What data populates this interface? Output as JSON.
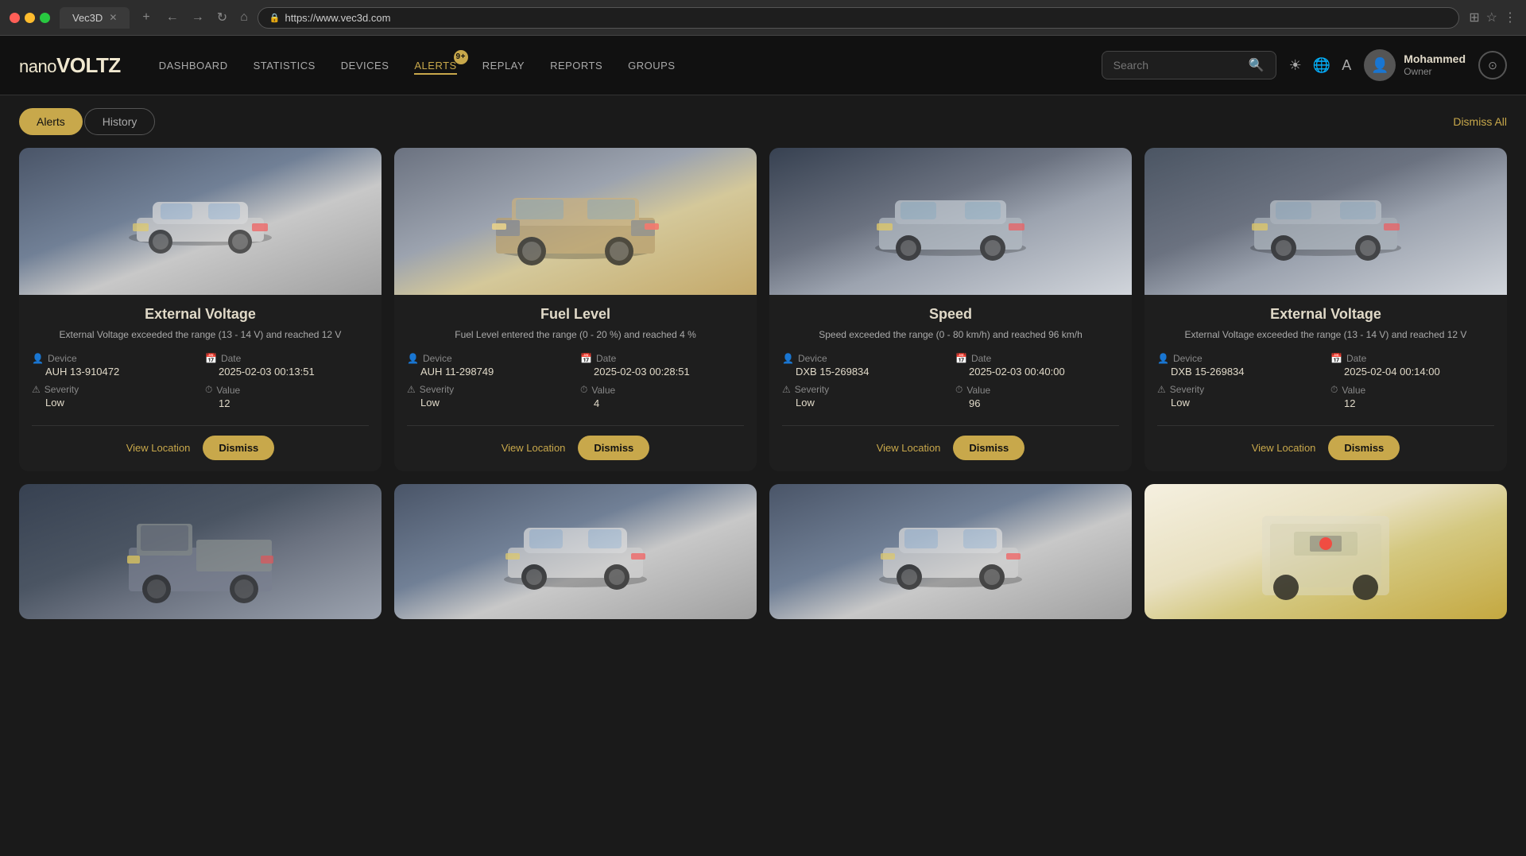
{
  "browser": {
    "tab_title": "Vec3D",
    "url": "https://www.vec3d.com",
    "plus_label": "+"
  },
  "header": {
    "logo": "nanoVOLTZ",
    "nav": [
      {
        "label": "DASHBOARD",
        "active": false
      },
      {
        "label": "STATISTICS",
        "active": false
      },
      {
        "label": "DEVICES",
        "active": false
      },
      {
        "label": "ALERTS",
        "active": true,
        "badge": "9+"
      },
      {
        "label": "REPLAY",
        "active": false
      },
      {
        "label": "REPORTS",
        "active": false
      },
      {
        "label": "GROUPS",
        "active": false
      }
    ],
    "search_placeholder": "Search",
    "user_name": "Mohammed",
    "user_role": "Owner"
  },
  "page": {
    "tabs": [
      {
        "label": "Alerts",
        "active": true
      },
      {
        "label": "History",
        "active": false
      }
    ],
    "dismiss_all_label": "Dismiss All"
  },
  "alerts": [
    {
      "id": 1,
      "title": "External Voltage",
      "description": "External Voltage exceeded the range (13 - 14 V) and reached 12 V",
      "device_label": "Device",
      "device_value": "AUH 13-910472",
      "date_label": "Date",
      "date_value": "2025-02-03 00:13:51",
      "severity_label": "Severity",
      "severity_value": "Low",
      "value_label": "Value",
      "value_value": "12",
      "view_location_label": "View Location",
      "dismiss_label": "Dismiss",
      "img_class": "car-img-1"
    },
    {
      "id": 2,
      "title": "Fuel Level",
      "description": "Fuel Level entered the range (0 - 20 %) and reached 4 %",
      "device_label": "Device",
      "device_value": "AUH 11-298749",
      "date_label": "Date",
      "date_value": "2025-02-03 00:28:51",
      "severity_label": "Severity",
      "severity_value": "Low",
      "value_label": "Value",
      "value_value": "4",
      "view_location_label": "View Location",
      "dismiss_label": "Dismiss",
      "img_class": "car-img-2"
    },
    {
      "id": 3,
      "title": "Speed",
      "description": "Speed exceeded the range (0 - 80 km/h) and reached 96 km/h",
      "device_label": "Device",
      "device_value": "DXB 15-269834",
      "date_label": "Date",
      "date_value": "2025-02-03 00:40:00",
      "severity_label": "Severity",
      "severity_value": "Low",
      "value_label": "Value",
      "value_value": "96",
      "view_location_label": "View Location",
      "dismiss_label": "Dismiss",
      "img_class": "car-img-3"
    },
    {
      "id": 4,
      "title": "External Voltage",
      "description": "External Voltage exceeded the range (13 - 14 V) and reached 12 V",
      "device_label": "Device",
      "device_value": "DXB 15-269834",
      "date_label": "Date",
      "date_value": "2025-02-04 00:14:00",
      "severity_label": "Severity",
      "severity_value": "Low",
      "value_label": "Value",
      "value_value": "12",
      "view_location_label": "View Location",
      "dismiss_label": "Dismiss",
      "img_class": "car-img-4"
    }
  ],
  "bottom_cards": [
    {
      "img_class": "car-img-5"
    },
    {
      "img_class": "car-img-6"
    },
    {
      "img_class": "car-img-7"
    },
    {
      "img_class": "car-img-8"
    }
  ]
}
